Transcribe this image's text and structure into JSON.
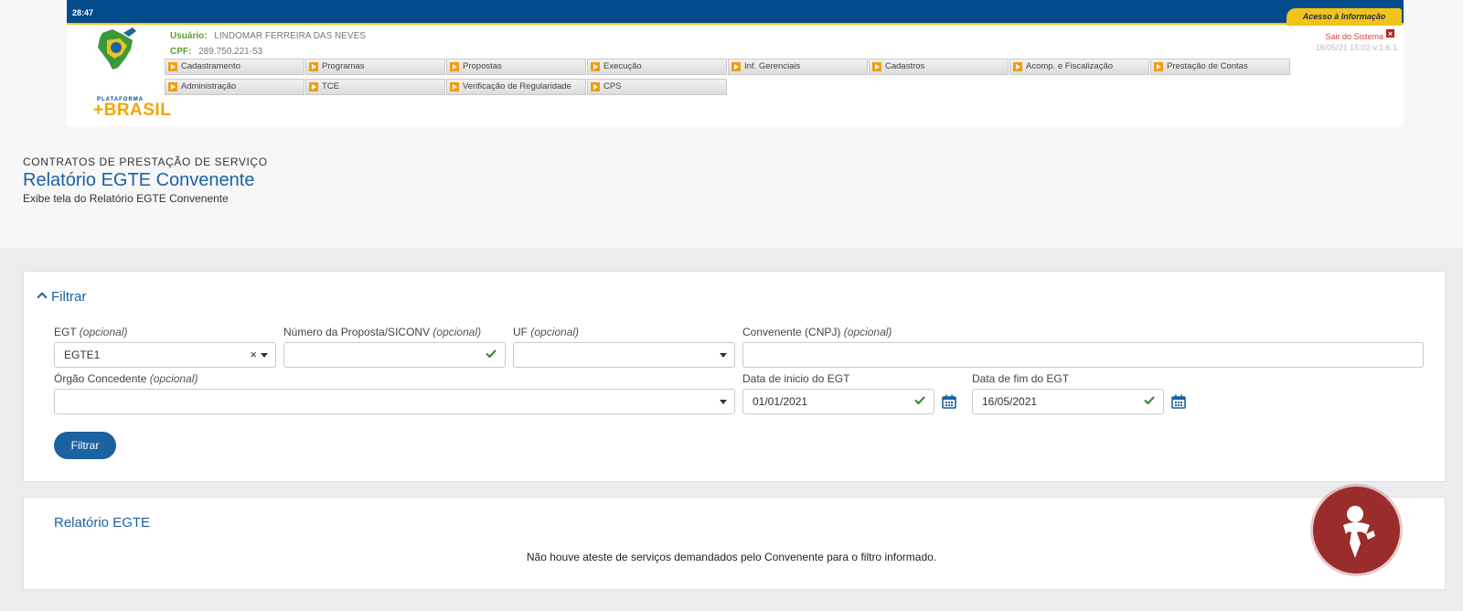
{
  "header": {
    "timer": "28:47",
    "acesso_label": "Acesso à Informação",
    "logo_line1": "PLATAFORMA",
    "logo_line2": "+BRASIL",
    "user_label": "Usuário:",
    "user_name": "LINDOMAR FERREIRA DAS NEVES",
    "cpf_label": "CPF:",
    "cpf_value": "289.750.221-53",
    "logout_label": "Sair do Sistema",
    "logout_icon": "close-icon",
    "version": "16/05/21 15:02-v.1.6.1"
  },
  "menu": {
    "row1": [
      "Cadastramento",
      "Programas",
      "Propostas",
      "Execução",
      "Inf. Gerenciais",
      "Cadastros",
      "Acomp. e Fiscalização",
      "Prestação de Contas"
    ],
    "row2": [
      "Administração",
      "TCE",
      "Verificação de Regularidade",
      "CPS"
    ]
  },
  "page": {
    "kicker": "CONTRATOS DE PRESTAÇÃO DE SERVIÇO",
    "title": "Relatório EGTE Convenente",
    "subtitle": "Exibe tela do Relatório EGTE Convenente"
  },
  "filter": {
    "toggle_label": "Filtrar",
    "optional": "(opcional)",
    "egt": {
      "label": "EGT",
      "value": "EGTE1"
    },
    "proposta": {
      "label": "Número da Proposta/SICONV",
      "value": ""
    },
    "uf": {
      "label": "UF",
      "value": ""
    },
    "convenente": {
      "label": "Convenente (CNPJ)",
      "value": ""
    },
    "orgao": {
      "label": "Órgão Concedente",
      "value": ""
    },
    "data_inicio": {
      "label": "Data de inicio do EGT",
      "value": "01/01/2021"
    },
    "data_fim": {
      "label": "Data de fim do EGT",
      "value": "16/05/2021"
    },
    "submit_label": "Filtrar"
  },
  "report": {
    "title": "Relatório EGTE",
    "message": "Não houve ateste de serviços demandados pelo Convenente para o filtro informado."
  },
  "colors": {
    "primary": "#1b62a0",
    "header_blue": "#034c8c",
    "accent_yellow": "#f0c419",
    "success_green": "#3a8a3a",
    "vlibras_red": "#9b2c2c"
  }
}
